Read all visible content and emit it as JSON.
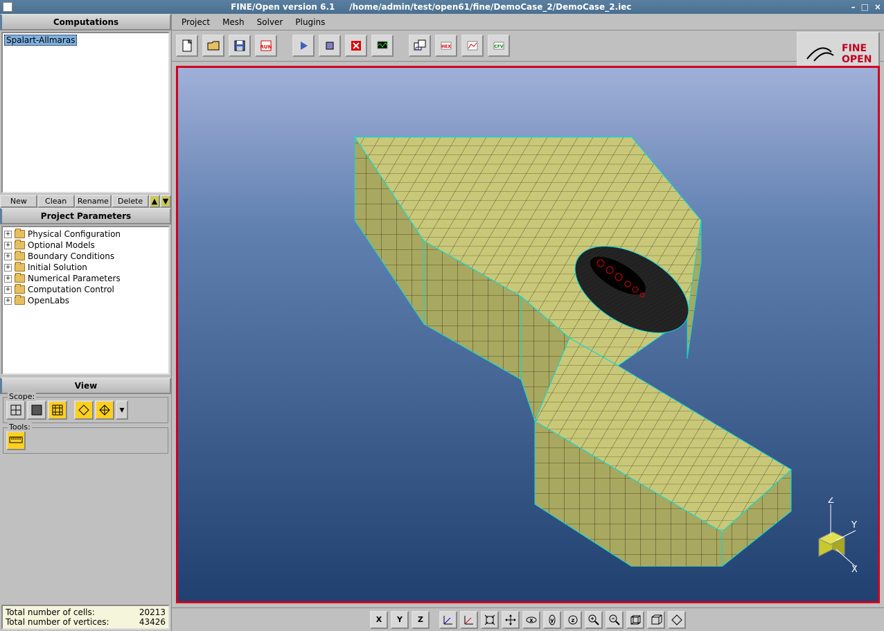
{
  "titlebar": {
    "app": "FINE/Open version 6.1",
    "path": "/home/admin/test/open61/fine/DemoCase_2/DemoCase_2.iec"
  },
  "menus": [
    "Project",
    "Mesh",
    "Solver",
    "Plugins"
  ],
  "logo": {
    "line1": "FINE",
    "line2": "OPEN"
  },
  "panels": {
    "computations": "Computations",
    "project_params": "Project Parameters",
    "view": "View"
  },
  "computations": {
    "items": [
      "Spalart-Allmaras"
    ],
    "buttons": {
      "new": "New",
      "clean": "Clean",
      "rename": "Rename",
      "delete": "Delete"
    }
  },
  "tree": [
    "Physical Configuration",
    "Optional Models",
    "Boundary Conditions",
    "Initial Solution",
    "Numerical Parameters",
    "Computation Control",
    "OpenLabs"
  ],
  "view_panel": {
    "scope_label": "Scope:",
    "tools_label": "Tools:"
  },
  "stats": {
    "cells_label": "Total number of cells:",
    "cells_value": "20213",
    "vertices_label": "Total number of vertices:",
    "vertices_value": "43426"
  },
  "bottom_buttons": [
    "X",
    "Y",
    "Z"
  ],
  "axes": {
    "x": "X",
    "y": "Y",
    "z": "Z"
  }
}
